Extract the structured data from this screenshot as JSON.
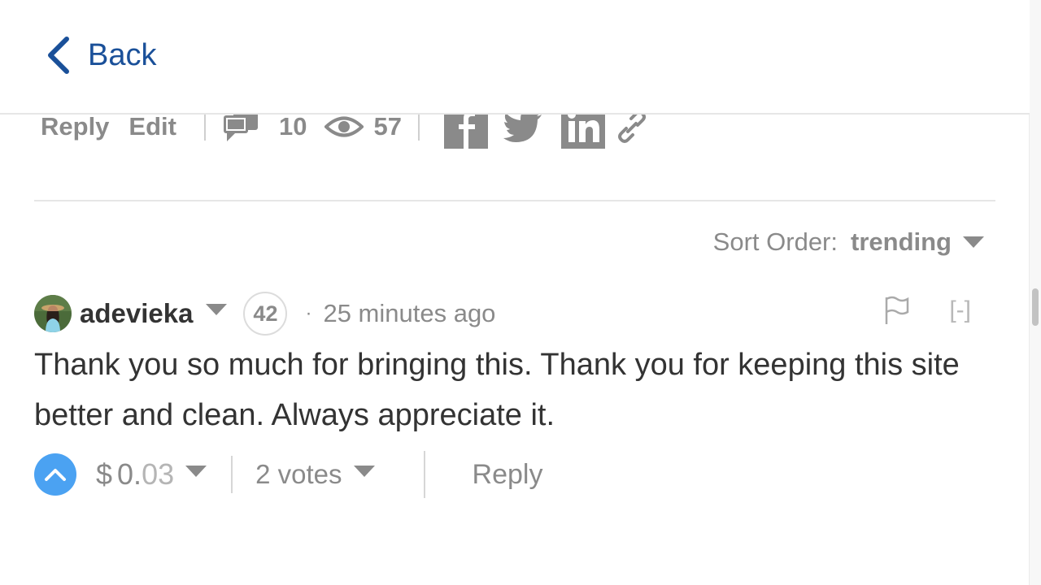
{
  "header": {
    "back_label": "Back"
  },
  "post_actions": {
    "reply_label": "Reply",
    "edit_label": "Edit",
    "comments_count": "10",
    "views_count": "57"
  },
  "sort": {
    "label": "Sort Order:",
    "value": "trending"
  },
  "comment": {
    "author": "adevieka",
    "reputation": "42",
    "separator": "·",
    "time": "25 minutes ago",
    "collapse_label": "[-]",
    "body_line1": "Thank you so much for bringing this. Thank you for keeping this site",
    "body_line2": "better and clean. Always appreciate it.",
    "payout_currency": "$",
    "payout_whole": "0.",
    "payout_fraction": "03",
    "votes_label": "2 votes",
    "reply_label": "Reply"
  },
  "colors": {
    "link_blue": "#1a5099",
    "upvote_blue": "#4ba2f2",
    "muted_gray": "#8a8a8a",
    "text_dark": "#333333"
  },
  "icons": {
    "back": "chevron-left-icon",
    "comments": "comments-icon",
    "views": "eye-icon",
    "facebook": "facebook-icon",
    "twitter": "twitter-icon",
    "linkedin": "linkedin-icon",
    "link": "link-icon",
    "flag": "flag-icon",
    "upvote": "chevron-up-icon"
  }
}
